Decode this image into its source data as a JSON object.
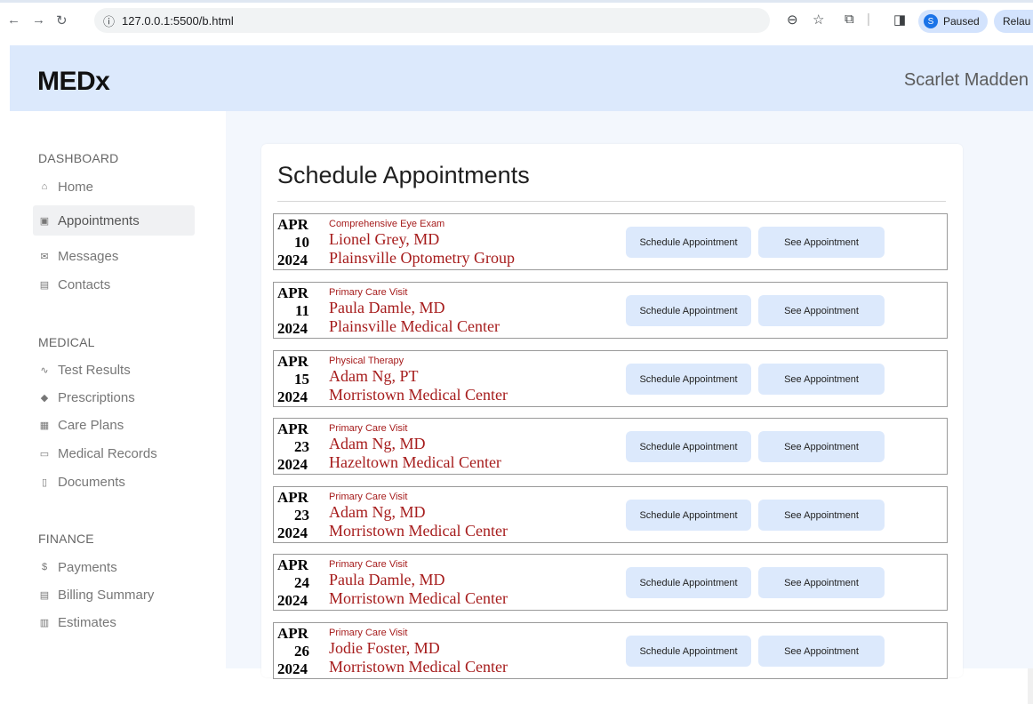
{
  "browser": {
    "url": "127.0.0.1:5500/b.html",
    "profile_initial": "S",
    "profile_status": "Paused",
    "relaunch_label": "Relau"
  },
  "header": {
    "logo": "MEDx",
    "user_name": "Scarlet Madden"
  },
  "sidebar": {
    "sections": [
      {
        "title": "DASHBOARD",
        "items": [
          {
            "label": "Home",
            "icon": "home-icon",
            "glyph": "⌂"
          },
          {
            "label": "Appointments",
            "icon": "calendar-icon",
            "glyph": "▣",
            "active": true
          },
          {
            "label": "Messages",
            "icon": "mail-icon",
            "glyph": "✉"
          },
          {
            "label": "Contacts",
            "icon": "contact-card-icon",
            "glyph": "▤"
          }
        ]
      },
      {
        "title": "MEDICAL",
        "items": [
          {
            "label": "Test Results",
            "icon": "pulse-icon",
            "glyph": "∿"
          },
          {
            "label": "Prescriptions",
            "icon": "pill-icon",
            "glyph": "◆"
          },
          {
            "label": "Care Plans",
            "icon": "building-icon",
            "glyph": "▦"
          },
          {
            "label": "Medical Records",
            "icon": "folder-icon",
            "glyph": "▭"
          },
          {
            "label": "Documents",
            "icon": "document-icon",
            "glyph": "▯"
          }
        ]
      },
      {
        "title": "FINANCE",
        "items": [
          {
            "label": "Payments",
            "icon": "dollar-icon",
            "glyph": "$"
          },
          {
            "label": "Billing Summary",
            "icon": "receipt-icon",
            "glyph": "▤"
          },
          {
            "label": "Estimates",
            "icon": "calculator-icon",
            "glyph": "▥"
          }
        ]
      }
    ]
  },
  "main": {
    "title": "Schedule Appointments",
    "schedule_label": "Schedule Appointment",
    "see_label": "See Appointment",
    "appointments": [
      {
        "month": "APR",
        "day": "10",
        "year": "2024",
        "type": "Comprehensive Eye Exam",
        "doctor": "Lionel Grey, MD",
        "location": "Plainsville Optometry Group"
      },
      {
        "month": "APR",
        "day": "11",
        "year": "2024",
        "type": "Primary Care Visit",
        "doctor": "Paula Damle, MD",
        "location": "Plainsville Medical Center"
      },
      {
        "month": "APR",
        "day": "15",
        "year": "2024",
        "type": "Physical Therapy",
        "doctor": "Adam Ng, PT",
        "location": "Morristown Medical Center"
      },
      {
        "month": "APR",
        "day": "23",
        "year": "2024",
        "type": "Primary Care Visit",
        "doctor": "Adam Ng, MD",
        "location": "Hazeltown Medical Center"
      },
      {
        "month": "APR",
        "day": "23",
        "year": "2024",
        "type": "Primary Care Visit",
        "doctor": "Adam Ng, MD",
        "location": "Morristown Medical Center"
      },
      {
        "month": "APR",
        "day": "24",
        "year": "2024",
        "type": "Primary Care Visit",
        "doctor": "Paula Damle, MD",
        "location": "Morristown Medical Center"
      },
      {
        "month": "APR",
        "day": "26",
        "year": "2024",
        "type": "Primary Care Visit",
        "doctor": "Jodie Foster, MD",
        "location": "Morristown Medical Center"
      }
    ]
  }
}
